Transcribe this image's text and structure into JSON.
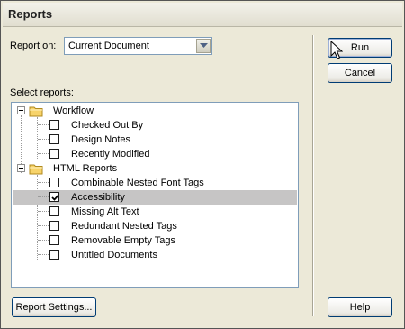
{
  "window": {
    "title": "Reports"
  },
  "report_on": {
    "label": "Report on:",
    "selected": "Current Document"
  },
  "select_reports_label": "Select reports:",
  "tree": {
    "groups": [
      {
        "label": "Workflow",
        "expanded": true,
        "items": [
          {
            "label": "Checked Out By",
            "checked": false
          },
          {
            "label": "Design Notes",
            "checked": false
          },
          {
            "label": "Recently Modified",
            "checked": false
          }
        ]
      },
      {
        "label": "HTML Reports",
        "expanded": true,
        "items": [
          {
            "label": "Combinable Nested Font Tags",
            "checked": false
          },
          {
            "label": "Accessibility",
            "checked": true,
            "selected": true
          },
          {
            "label": "Missing Alt Text",
            "checked": false
          },
          {
            "label": "Redundant Nested Tags",
            "checked": false
          },
          {
            "label": "Removable Empty Tags",
            "checked": false
          },
          {
            "label": "Untitled Documents",
            "checked": false
          }
        ]
      }
    ]
  },
  "buttons": {
    "run": "Run",
    "cancel": "Cancel",
    "help": "Help",
    "report_settings": "Report Settings..."
  },
  "colors": {
    "dialog_bg": "#ece9d8",
    "selection": "#c6c5c5",
    "border": "#7f9db9",
    "button_border": "#003c74"
  }
}
